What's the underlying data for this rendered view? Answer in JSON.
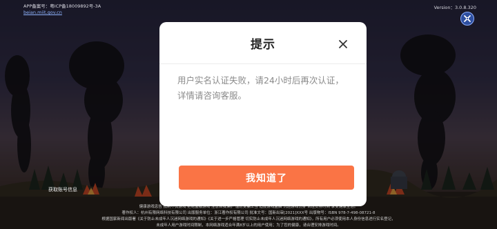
{
  "header": {
    "record_line1": "APP备案号：粤ICP备18009892号-3A",
    "record_line2": "beian.miit.gov.cn",
    "version": "Version：3.0.8.320"
  },
  "icons": {
    "settings": "settings-icon",
    "close": "close-icon"
  },
  "background": {
    "account_info": "获取账号信息",
    "footer_line1": "健康游戏忠告 抵制不良游戏 拒绝盗版游戏 注意自我保护 谨防受骗上当 适度游戏益脑 沉迷游戏伤身 合理安排时间 享受健康生活。",
    "footer_line2": "著作权人：杭州有限网络科技有限公司 出版服务单位：浙江著作权有限公司 批准文号：国新出审[2021]XXX号 出版物号：ISBN 978-7-498-08721-8",
    "footer_line3": "根据国家新闻出版署《关于防止未成年人沉迷网络游戏的通知》《关于进一步严格管理 切实防止未成年人沉迷网络游戏的通知》，所有用户必须使用本人身份信息进行实名登记，",
    "footer_line4": "未成年人用户游戏时间限制，本网络游戏适合年满8岁以上的用户使用；为了您的健康，请合理安排游戏时间。"
  },
  "dialog": {
    "title": "提示",
    "message": "用户实名认证失败，请24小时后再次认证，详情请咨询客服。",
    "ok_label": "我知道了"
  },
  "colors": {
    "accent": "#fa7445",
    "settings_bg": "#2e4fa0"
  }
}
